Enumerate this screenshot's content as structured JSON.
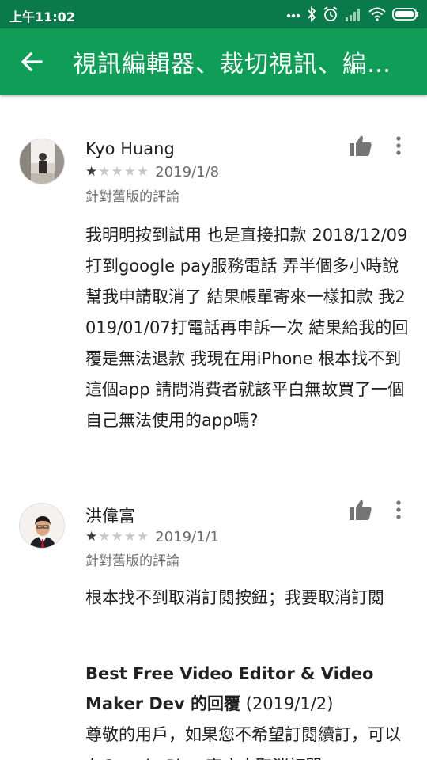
{
  "status_bar": {
    "time": "上午11:02",
    "icons": [
      "more-dots-icon",
      "bluetooth-icon",
      "alarm-icon",
      "signal-icon",
      "wifi-icon",
      "battery-icon"
    ]
  },
  "app_bar": {
    "back_icon": "arrow-back-icon",
    "title": "視訊編輯器、裁切視訊、編輯器..."
  },
  "reviews": [
    {
      "name": "Kyo Huang",
      "rating": 1,
      "max_rating": 5,
      "date": "2019/1/8",
      "version_note": "針對舊版的評論",
      "body": "我明明按到試用 也是直接扣款 2018/12/09打到google pay服務電話 弄半個多小時說幫我申請取消了 結果帳單寄來一樣扣款 我2019/01/07打電話再申訴一次 結果給我的回覆是無法退款 我現在用iPhone 根本找不到這個app 請問消費者就該平白無故買了一個自己無法使用的app嗎?"
    },
    {
      "name": "洪偉富",
      "rating": 1,
      "max_rating": 5,
      "date": "2019/1/1",
      "version_note": "針對舊版的評論",
      "body": "根本找不到取消訂閱按鈕；我要取消訂閱",
      "reply": {
        "developer": "Best Free Video Editor & Video Maker Dev 的回覆",
        "date": "(2019/1/2)",
        "body": "尊敬的用戶，如果您不希望訂閱續訂，可以在Google Play 商店中取消訂閱"
      }
    }
  ],
  "colors": {
    "status_bar": "#0b7a4b",
    "app_bar": "#0f9d58",
    "star_on": "#3b3b3b",
    "star_off": "#c8c8c8",
    "secondary_text": "#6d6d6d"
  }
}
